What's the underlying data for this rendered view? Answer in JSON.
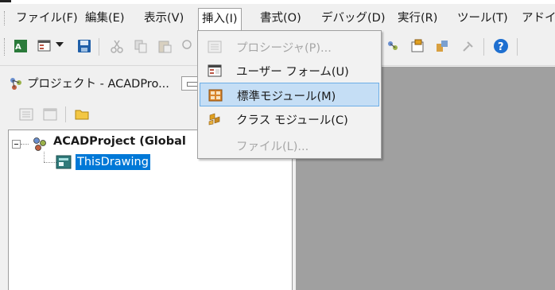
{
  "menubar": {
    "items": [
      {
        "label": "ファイル(F)"
      },
      {
        "label": "編集(E)"
      },
      {
        "label": "表示(V)"
      },
      {
        "label": "挿入(I)"
      },
      {
        "label": "書式(O)"
      },
      {
        "label": "デバッグ(D)"
      },
      {
        "label": "実行(R)"
      },
      {
        "label": "ツール(T)"
      },
      {
        "label": "アドイン"
      }
    ]
  },
  "insert_menu": {
    "items": [
      {
        "label": "プロシージャ(P)...",
        "icon": "procedure-icon",
        "enabled": false
      },
      {
        "label": "ユーザー フォーム(U)",
        "icon": "userform-icon",
        "enabled": true
      },
      {
        "label": "標準モジュール(M)",
        "icon": "standard-module-icon",
        "enabled": true,
        "highlighted": true
      },
      {
        "label": "クラス モジュール(C)",
        "icon": "class-module-icon",
        "enabled": true
      },
      {
        "label": "ファイル(L)...",
        "icon": "",
        "enabled": false
      }
    ]
  },
  "project_explorer": {
    "title": "プロジェクト - ACADPro...",
    "root": {
      "label": "ACADProject (Global"
    },
    "child": {
      "label": "ThisDrawing"
    }
  },
  "colors": {
    "selection": "#0078d7",
    "menu_highlight": "#c5def5",
    "workspace": "#a0a0a0"
  }
}
